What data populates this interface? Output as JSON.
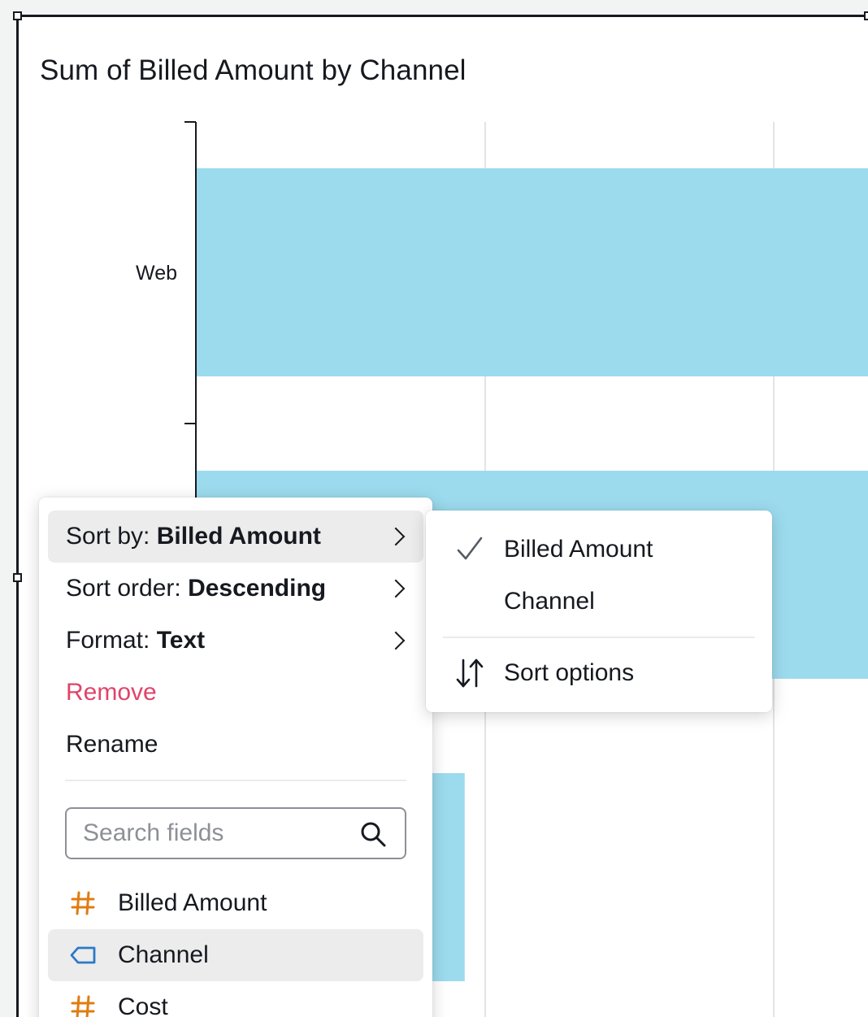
{
  "visual": {
    "title": "Sum of Billed Amount by Channel"
  },
  "chart_data": {
    "type": "bar",
    "orientation": "horizontal",
    "title": "Sum of Billed Amount by Channel",
    "categories": [
      "Web",
      "",
      ""
    ],
    "values": [
      100,
      100,
      40
    ],
    "grid": true,
    "bar_color": "#9cdbee",
    "note_categories": "only the first category label 'Web' is visible; other bars are partially occluded by menus"
  },
  "main_menu": {
    "sort_by_prefix": "Sort by: ",
    "sort_by_value": "Billed Amount",
    "sort_order_prefix": "Sort order: ",
    "sort_order_value": "Descending",
    "format_prefix": "Format: ",
    "format_value": "Text",
    "remove_label": "Remove",
    "rename_label": "Rename",
    "search_placeholder": "Search fields",
    "fields": [
      {
        "label": "Billed Amount",
        "icon": "hash-icon"
      },
      {
        "label": "Channel",
        "icon": "tag-icon"
      },
      {
        "label": "Cost",
        "icon": "hash-icon"
      }
    ]
  },
  "sub_menu": {
    "options": [
      "Billed Amount",
      "Channel"
    ],
    "selected": "Billed Amount",
    "sort_options_label": "Sort options"
  },
  "colors": {
    "remove": "#e0436a",
    "measure_icon": "#df7c12",
    "dimension_icon": "#2d79c7",
    "bar": "#9cdbee"
  }
}
